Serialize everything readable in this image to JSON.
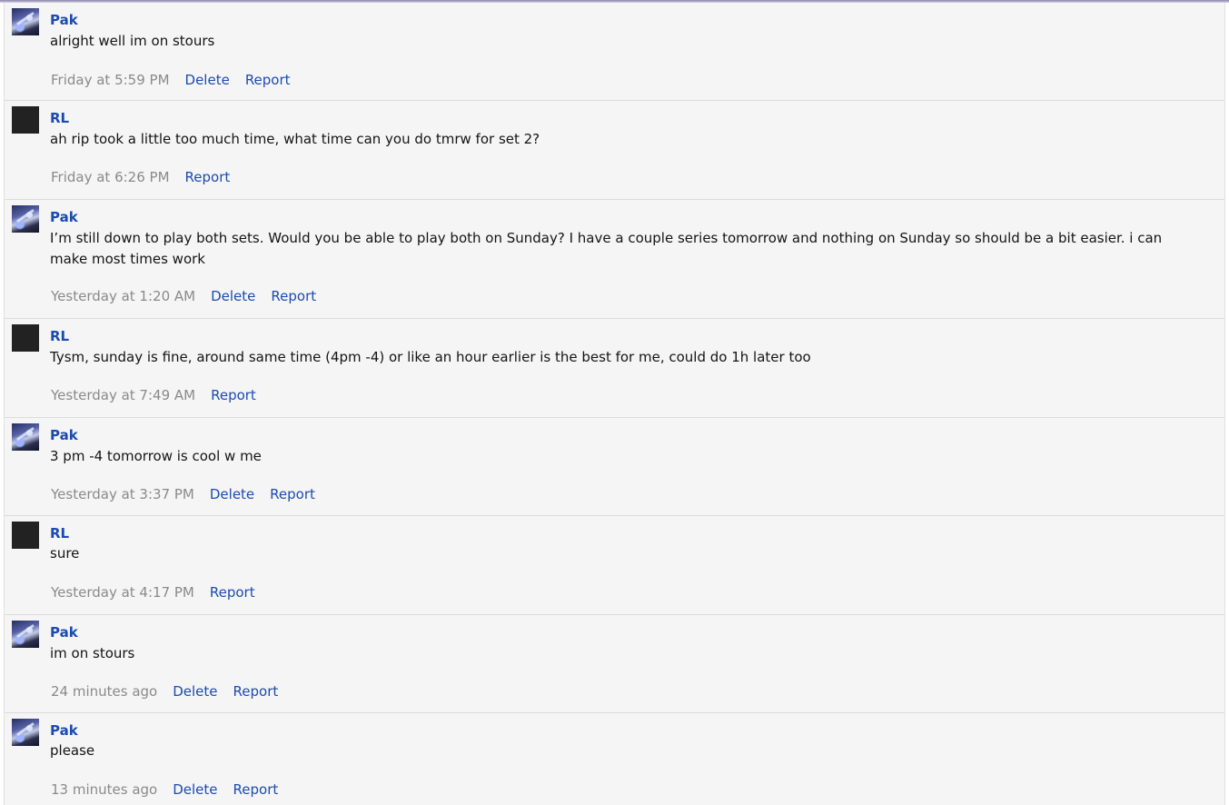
{
  "messages": [
    {
      "author": "Pak",
      "text": "alright well im on stours",
      "time": "Friday at 5:59 PM",
      "actions": [
        "Delete",
        "Report"
      ]
    },
    {
      "author": "RL",
      "text": "ah rip took a little too much time, what time can you do tmrw for set 2?",
      "time": "Friday at 6:26 PM",
      "actions": [
        "Report"
      ]
    },
    {
      "author": "Pak",
      "text": "I’m still down to play both sets. Would you be able to play both on Sunday? I have a couple series tomorrow and nothing on Sunday so should be a bit easier. i can make most times work",
      "time": "Yesterday at 1:20 AM",
      "actions": [
        "Delete",
        "Report"
      ]
    },
    {
      "author": "RL",
      "text": "Tysm, sunday is fine, around same time (4pm -4) or like an hour earlier is the best for me, could do 1h later too",
      "time": "Yesterday at 7:49 AM",
      "actions": [
        "Report"
      ]
    },
    {
      "author": "Pak",
      "text": "3 pm -4 tomorrow is cool w me",
      "time": "Yesterday at 3:37 PM",
      "actions": [
        "Delete",
        "Report"
      ]
    },
    {
      "author": "RL",
      "text": "sure",
      "time": "Yesterday at 4:17 PM",
      "actions": [
        "Report"
      ]
    },
    {
      "author": "Pak",
      "text": "im on stours",
      "time": "24 minutes ago",
      "actions": [
        "Delete",
        "Report"
      ]
    },
    {
      "author": "Pak",
      "text": "please",
      "time": "13 minutes ago",
      "actions": [
        "Delete",
        "Report"
      ]
    }
  ]
}
